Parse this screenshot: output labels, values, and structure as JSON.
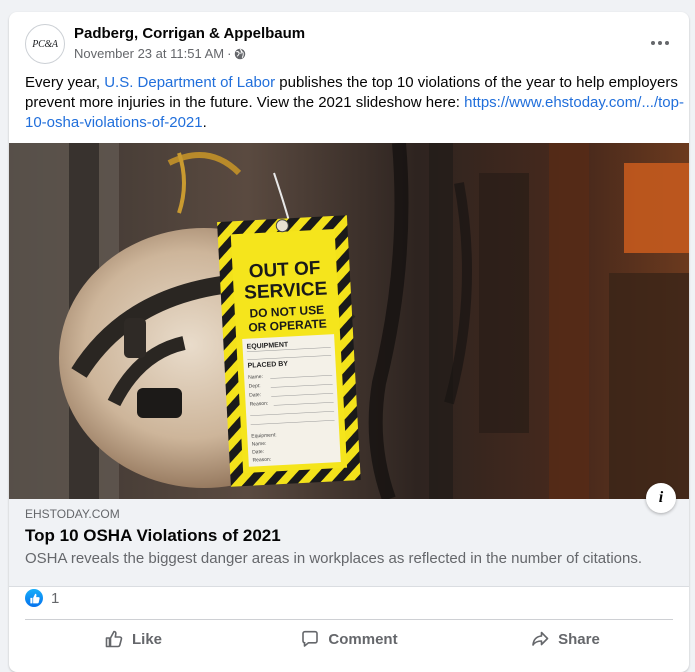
{
  "post": {
    "page_name": "Padberg, Corrigan & Appelbaum",
    "avatar_text": "PC&A",
    "timestamp": "November 23 at 11:51 AM",
    "separator": " · ",
    "audience_icon": "globe-icon",
    "more_icon": "more-options-icon",
    "text_part1": "Every year, ",
    "text_link": "U.S. Department of Labor",
    "text_part2": " publishes the top 10 violations of the year to help employers prevent more injuries in the future. View the 2021 slideshow here: ",
    "url": "https://www.ehstoday.com/.../top-10-osha-violations-of-2021",
    "url_end": "."
  },
  "image": {
    "tag_line1": "OUT OF",
    "tag_line2": "SERVICE",
    "tag_line3": "DO NOT USE",
    "tag_line4": "OR OPERATE",
    "tag_field1": "EQUIPMENT",
    "tag_field2": "PLACED BY",
    "tag_name": "Name:",
    "tag_dept": "Dept:",
    "tag_date": "Date:",
    "tag_reason": "Reason:",
    "tag_equipment": "Equipment:",
    "tag_name2": "Name:",
    "tag_date2": "Date:",
    "tag_reason2": "Reason:"
  },
  "link_preview": {
    "domain": "EHSTODAY.COM",
    "title": "Top 10 OSHA Violations of 2021",
    "description": "OSHA reveals the biggest danger areas in workplaces as reflected in the number of citations.",
    "info_icon": "i"
  },
  "reactions": {
    "count": "1"
  },
  "actions": {
    "like": "Like",
    "comment": "Comment",
    "share": "Share"
  },
  "colors": {
    "link_blue": "#216fdb",
    "like_blue": "#0571ed",
    "secondary_text": "#65676b",
    "background": "#f0f2f5"
  }
}
